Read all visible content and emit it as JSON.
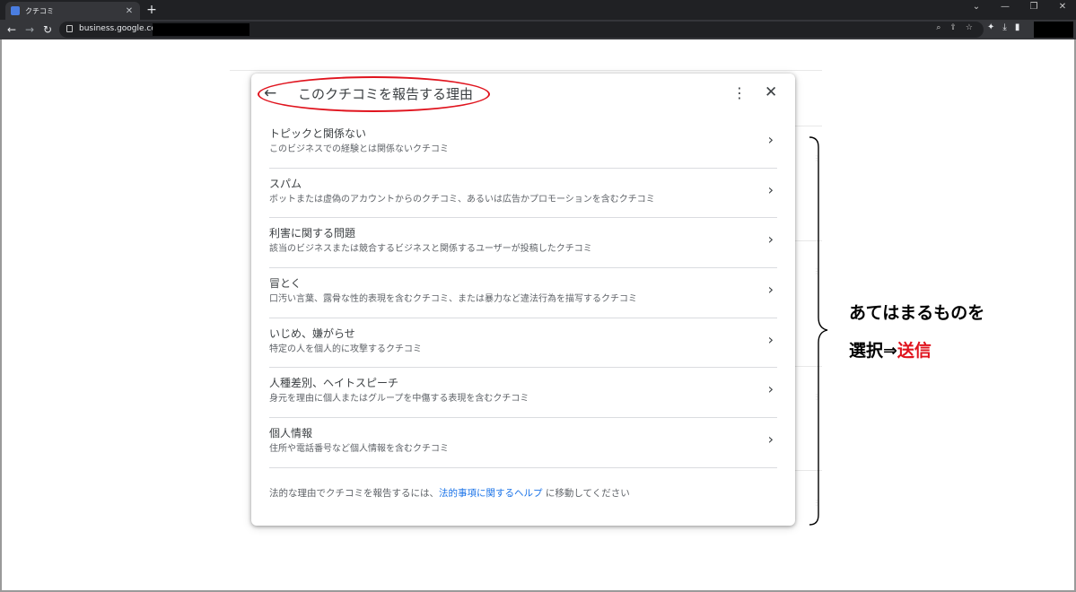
{
  "browser": {
    "tab_title": "クチコミ",
    "tab_close": "✕",
    "new_tab": "+",
    "url": "business.google.com/",
    "window_controls": [
      "⌄",
      "—",
      "❐",
      "✕"
    ]
  },
  "dialog": {
    "title": "このクチコミを報告する理由",
    "back_glyph": "←",
    "more_glyph": "⋮",
    "close_glyph": "✕",
    "items": [
      {
        "title": "トピックと関係ない",
        "description": "このビジネスでの経験とは関係ないクチコミ"
      },
      {
        "title": "スパム",
        "description": "ボットまたは虚偽のアカウントからのクチコミ、あるいは広告かプロモーションを含むクチコミ"
      },
      {
        "title": "利害に関する問題",
        "description": "該当のビジネスまたは競合するビジネスと関係するユーザーが投稿したクチコミ"
      },
      {
        "title": "冒とく",
        "description": "口汚い言葉、露骨な性的表現を含むクチコミ、または暴力など違法行為を描写するクチコミ"
      },
      {
        "title": "いじめ、嫌がらせ",
        "description": "特定の人を個人的に攻撃するクチコミ"
      },
      {
        "title": "人種差別、ヘイトスピーチ",
        "description": "身元を理由に個人またはグループを中傷する表現を含むクチコミ"
      },
      {
        "title": "個人情報",
        "description": "住所や電話番号など個人情報を含むクチコミ"
      }
    ],
    "chevron": "›",
    "footer": {
      "before": "法的な理由でクチコミを報告するには、",
      "link": "法的事項に関するヘルプ",
      "after": " に移動してください"
    }
  },
  "annotation": {
    "line1": "あてはまるものを",
    "line2_prefix": "選択⇒",
    "line2_highlight": "送信",
    "highlight_color": "#e0141e"
  }
}
